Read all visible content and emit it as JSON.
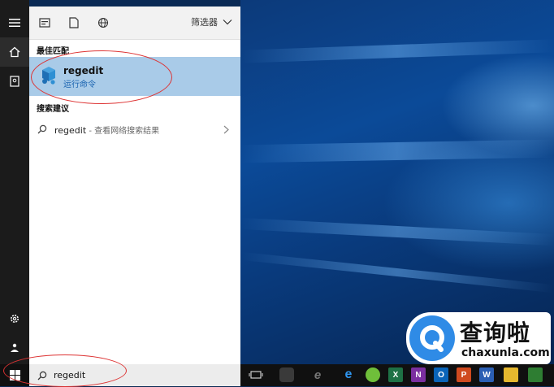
{
  "rail": {
    "items": [
      {
        "name": "hamburger-menu-icon"
      },
      {
        "name": "home-icon"
      },
      {
        "name": "notebook-icon"
      },
      {
        "name": "settings-gear-icon"
      },
      {
        "name": "feedback-icon"
      },
      {
        "name": "windows-start-icon"
      }
    ]
  },
  "panel": {
    "top_icons": [
      "apps-icon",
      "documents-icon",
      "web-globe-icon"
    ],
    "filter_label": "筛选器",
    "best_match_header": "最佳匹配",
    "best_match": {
      "title": "regedit",
      "subtitle": "运行命令"
    },
    "suggestions_header": "搜索建议",
    "suggestion": {
      "query": "regedit",
      "suffix": " - 查看网络搜索结果"
    }
  },
  "search": {
    "value": "regedit"
  },
  "taskbar": {
    "apps": [
      {
        "name": "task-view-icon",
        "color": "#101010"
      },
      {
        "name": "app-icon-gray",
        "color": "#3a3a3a"
      },
      {
        "name": "internet-explorer-icon",
        "color": "#101010",
        "letter": "e"
      },
      {
        "name": "edge-icon",
        "color": "#1e88e5",
        "letter": "e"
      },
      {
        "name": "green-app-icon",
        "color": "#6fbf3a"
      },
      {
        "name": "excel-icon",
        "color": "#1e7145",
        "letter": "X"
      },
      {
        "name": "onenote-icon",
        "color": "#7b2fa0",
        "letter": "N"
      },
      {
        "name": "outlook-icon",
        "color": "#0a64b8",
        "letter": "O"
      },
      {
        "name": "powerpoint-icon",
        "color": "#d04a1f",
        "letter": "P"
      },
      {
        "name": "word-icon",
        "color": "#2b5fb4",
        "letter": "W"
      },
      {
        "name": "file-explorer-icon",
        "color": "#e6b82e"
      },
      {
        "name": "photos-icon",
        "color": "#2e7d32"
      }
    ]
  },
  "watermark": {
    "cn": "查询啦",
    "en": "chaxunla.com"
  },
  "colors": {
    "highlight": "#a9cbe8",
    "accent": "#1b64b0",
    "annotation": "#d33333"
  }
}
